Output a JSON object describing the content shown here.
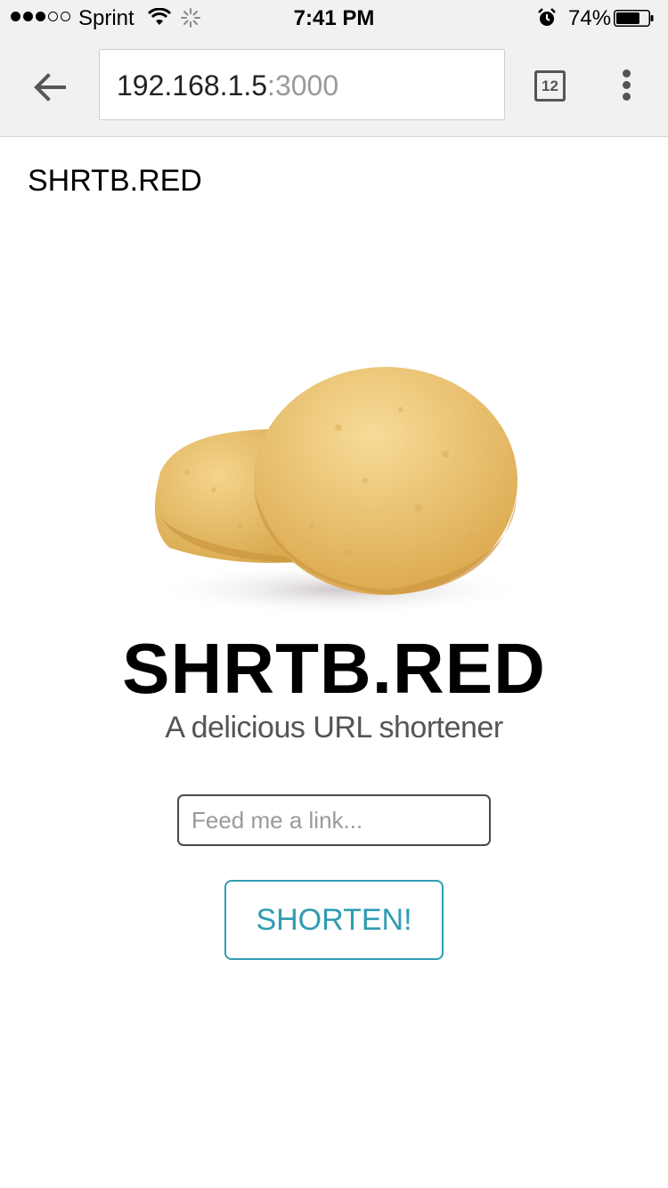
{
  "status_bar": {
    "signal_bars_filled": 3,
    "signal_bars_total": 5,
    "carrier": "Sprint",
    "time": "7:41 PM",
    "battery_percent": "74%",
    "battery_level": 0.74,
    "icons": [
      "wifi-icon",
      "loading-spinner-icon",
      "alarm-icon",
      "battery-icon"
    ]
  },
  "browser": {
    "url_host": "192.168.1.5",
    "url_port": ":3000",
    "tab_count": "12",
    "icons": [
      "back-arrow-icon",
      "tabs-icon",
      "overflow-menu-icon"
    ]
  },
  "page": {
    "brand": "SHRTB.RED",
    "hero_title": "SHRTB.RED",
    "tagline": "A delicious URL shortener",
    "link_input": {
      "placeholder": "Feed me a link...",
      "value": ""
    },
    "shorten_button": "SHORTEN!",
    "image": "shortbread-cookies-image"
  },
  "colors": {
    "accent": "#2f9cb2",
    "toolbar_bg": "#f1f1f1",
    "cookie": "#e8c06a"
  }
}
